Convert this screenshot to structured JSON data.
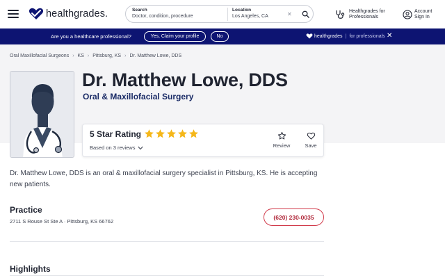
{
  "header": {
    "logo_text": "healthgrades.",
    "search": {
      "label": "Search",
      "placeholder": "Doctor, condition, procedure",
      "location_label": "Location",
      "location_value": "Los Angeles, CA"
    },
    "pro_link": [
      "Healthgrades for",
      "Professionals"
    ],
    "account": [
      "Account",
      "Sign In"
    ]
  },
  "banner": {
    "question": "Are you a healthcare professional?",
    "yes_label": "Yes, Claim your profile",
    "no_label": "No",
    "brand_name": "healthgrades",
    "brand_suffix": "for professionals"
  },
  "breadcrumb": [
    "Oral Maxillofacial Surgeons",
    "KS",
    "Pittsburg, KS",
    "Dr. Matthew Lowe, DDS"
  ],
  "profile": {
    "name": "Dr. Matthew Lowe, DDS",
    "specialty": "Oral & Maxillofacial Surgery"
  },
  "rating": {
    "title": "5 Star Rating",
    "stars": 5,
    "reviews_text": "Based on 3 reviews",
    "review_label": "Review",
    "save_label": "Save"
  },
  "bio": "Dr. Matthew Lowe, DDS is an oral & maxillofacial surgery specialist in Pittsburg, KS. He is accepting new patients.",
  "practice": {
    "title": "Practice",
    "address": "2711 S Rouse St Ste A · Pittsburg, KS 66762",
    "phone": "(620) 230-0035"
  },
  "highlights_title": "Highlights",
  "colors": {
    "brand_navy": "#0d1472",
    "star_gold": "#f5b71a",
    "phone_red": "#d13a4a",
    "accent_blue": "#1a2b66"
  }
}
